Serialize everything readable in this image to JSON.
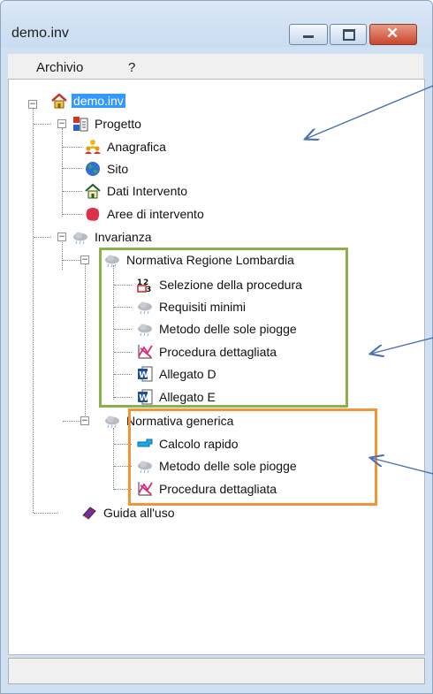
{
  "window": {
    "title": "demo.inv"
  },
  "menu": {
    "items": [
      "Archivio",
      "?"
    ]
  },
  "tree": {
    "root": "demo.inv",
    "progetto": "Progetto",
    "anagrafica": "Anagrafica",
    "sito": "Sito",
    "dati_intervento": "Dati Intervento",
    "aree_intervento": "Aree di intervento",
    "invarianza": "Invarianza",
    "normativa_lombardia": "Normativa Regione Lombardia",
    "selezione_procedura": "Selezione della procedura",
    "requisiti_minimi": "Requisiti minimi",
    "metodo_sole_piogge_1": "Metodo delle sole piogge",
    "procedura_dettagliata_1": "Procedura dettagliata",
    "allegato_d": "Allegato D",
    "allegato_e": "Allegato E",
    "normativa_generica": "Normativa generica",
    "calcolo_rapido": "Calcolo rapido",
    "metodo_sole_piogge_2": "Metodo delle sole piogge",
    "procedura_dettagliata_2": "Procedura dettagliata",
    "guida_uso": "Guida all'uso"
  },
  "colors": {
    "selection": "#3399ff",
    "box_green": "#8cb04a",
    "box_orange": "#f39536",
    "arrow": "#4a6fb5"
  }
}
